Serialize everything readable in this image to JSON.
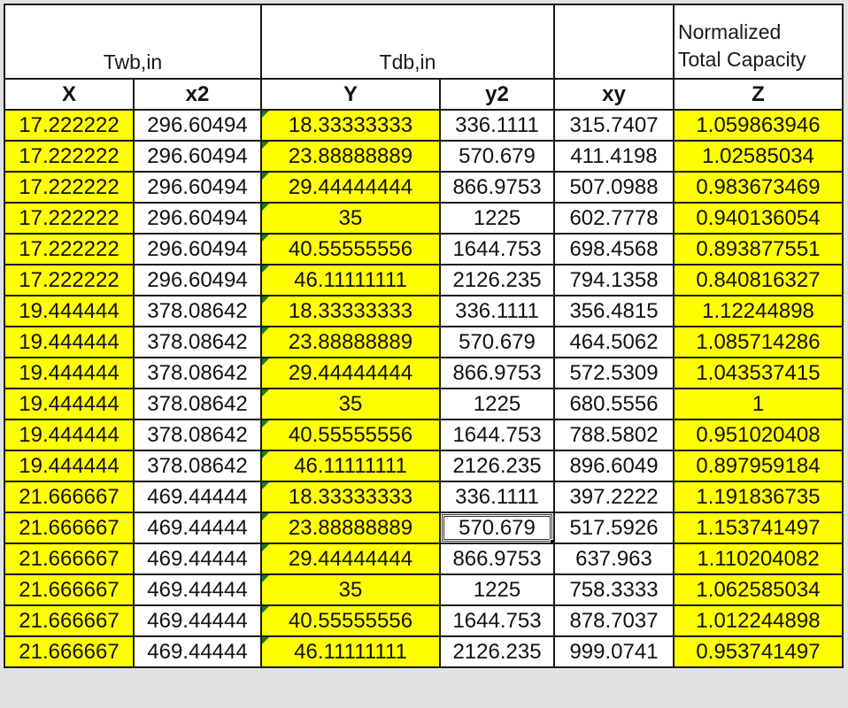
{
  "header": {
    "group_twb": "Twb,in",
    "group_tdb": "Tdb,in",
    "group_xy": "",
    "group_norm_line1": "Normalized",
    "group_norm_line2": "Total Capacity"
  },
  "columns": [
    "X",
    "x2",
    "Y",
    "y2",
    "xy",
    "Z"
  ],
  "rows": [
    [
      "17.222222",
      "296.60494",
      "18.33333333",
      "336.1111",
      "315.7407",
      "1.059863946"
    ],
    [
      "17.222222",
      "296.60494",
      "23.88888889",
      "570.679",
      "411.4198",
      "1.02585034"
    ],
    [
      "17.222222",
      "296.60494",
      "29.44444444",
      "866.9753",
      "507.0988",
      "0.983673469"
    ],
    [
      "17.222222",
      "296.60494",
      "35",
      "1225",
      "602.7778",
      "0.940136054"
    ],
    [
      "17.222222",
      "296.60494",
      "40.55555556",
      "1644.753",
      "698.4568",
      "0.893877551"
    ],
    [
      "17.222222",
      "296.60494",
      "46.11111111",
      "2126.235",
      "794.1358",
      "0.840816327"
    ],
    [
      "19.444444",
      "378.08642",
      "18.33333333",
      "336.1111",
      "356.4815",
      "1.12244898"
    ],
    [
      "19.444444",
      "378.08642",
      "23.88888889",
      "570.679",
      "464.5062",
      "1.085714286"
    ],
    [
      "19.444444",
      "378.08642",
      "29.44444444",
      "866.9753",
      "572.5309",
      "1.043537415"
    ],
    [
      "19.444444",
      "378.08642",
      "35",
      "1225",
      "680.5556",
      "1"
    ],
    [
      "19.444444",
      "378.08642",
      "40.55555556",
      "1644.753",
      "788.5802",
      "0.951020408"
    ],
    [
      "19.444444",
      "378.08642",
      "46.11111111",
      "2126.235",
      "896.6049",
      "0.897959184"
    ],
    [
      "21.666667",
      "469.44444",
      "18.33333333",
      "336.1111",
      "397.2222",
      "1.191836735"
    ],
    [
      "21.666667",
      "469.44444",
      "23.88888889",
      "570.679",
      "517.5926",
      "1.153741497"
    ],
    [
      "21.666667",
      "469.44444",
      "29.44444444",
      "866.9753",
      "637.963",
      "1.110204082"
    ],
    [
      "21.666667",
      "469.44444",
      "35",
      "1225",
      "758.3333",
      "1.062585034"
    ],
    [
      "21.666667",
      "469.44444",
      "40.55555556",
      "1644.753",
      "878.7037",
      "1.012244898"
    ],
    [
      "21.666667",
      "469.44444",
      "46.11111111",
      "2126.235",
      "999.0741",
      "0.953741497"
    ]
  ],
  "selected_cell": {
    "row": 13,
    "column": "y2",
    "value": "570.679"
  },
  "colors": {
    "highlight": "#ffff00",
    "border": "#1a1a1a",
    "error_indicator": "#1f7a1f"
  }
}
